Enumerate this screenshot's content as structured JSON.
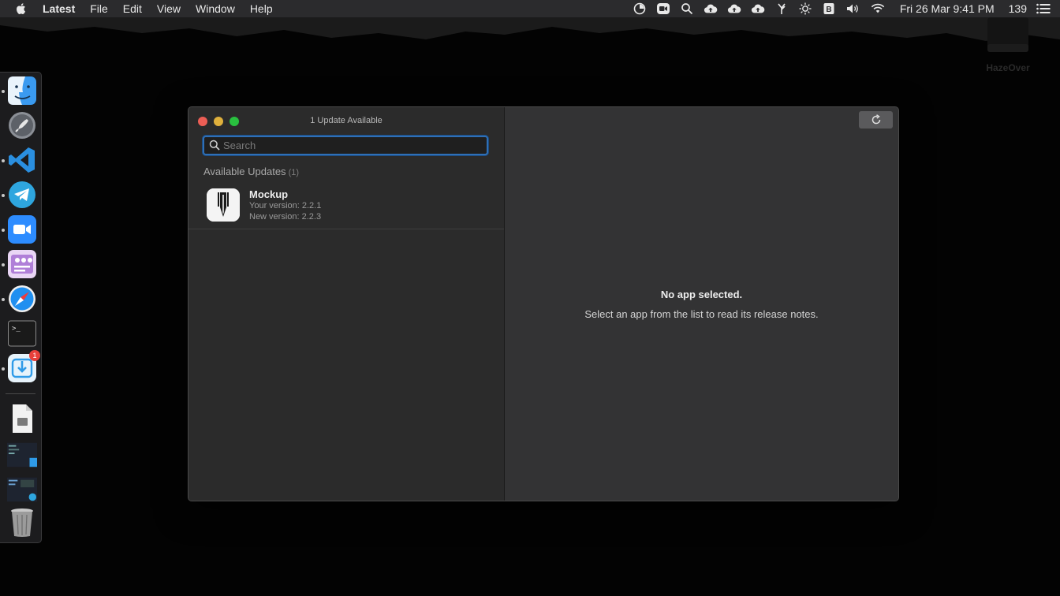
{
  "menubar": {
    "app_name": "Latest",
    "menus": [
      "File",
      "Edit",
      "View",
      "Window",
      "Help"
    ],
    "clock": "Fri 26 Mar  9:41 PM",
    "count": "139"
  },
  "desktop": {
    "drive_label": "HazeOver"
  },
  "dock": {
    "items": [
      "Finder",
      "Launchpad",
      "Visual Studio Code",
      "Telegram",
      "Zoom",
      "Mockup",
      "Safari",
      "Terminal",
      "Latest",
      "Document",
      "Screenshot 1",
      "Screenshot 2",
      "Trash"
    ],
    "latest_badge": "1"
  },
  "window": {
    "title": "1 Update Available",
    "search_placeholder": "Search",
    "section_label": "Available Updates",
    "section_count": "(1)",
    "app": {
      "name": "Mockup",
      "your_version": "Your version: 2.2.1",
      "new_version": "New version: 2.2.3"
    },
    "empty_title": "No app selected.",
    "empty_subtitle": "Select an app from the list to read its release notes."
  },
  "colors": {
    "accent": "#2f6fb6",
    "close": "#ec5e55",
    "minimize": "#dfb03c",
    "maximize": "#29c03f"
  }
}
